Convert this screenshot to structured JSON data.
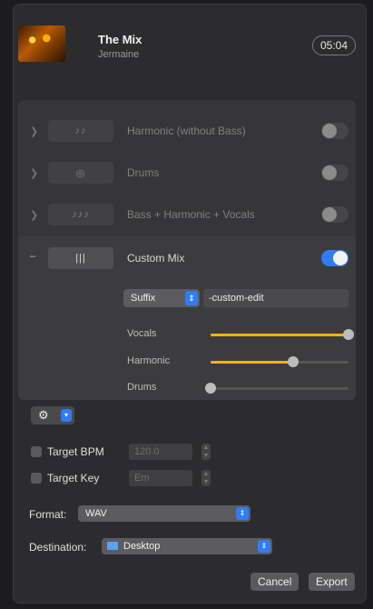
{
  "header": {
    "title": "The Mix",
    "artist": "Jermaine",
    "duration": "05:04"
  },
  "stems": [
    {
      "label": "Harmonic (without Bass)",
      "thumb": "♪♪",
      "enabled": false,
      "dimmed": true
    },
    {
      "label": "Drums",
      "thumb": "◎",
      "enabled": false,
      "dimmed": true
    },
    {
      "label": "Bass + Harmonic + Vocals",
      "thumb": "♪♪♪",
      "enabled": false,
      "dimmed": true
    },
    {
      "label": "Custom Mix",
      "thumb": "|||",
      "enabled": true,
      "dimmed": false
    }
  ],
  "custom": {
    "suffix_select": "Suffix",
    "suffix_value": "-custom-edit",
    "sliders": [
      {
        "label": "Vocals",
        "value": 1.0
      },
      {
        "label": "Harmonic",
        "value": 0.6
      },
      {
        "label": "Drums",
        "value": 0.0
      }
    ]
  },
  "options": {
    "target_bpm_label": "Target BPM",
    "target_bpm_value": "120.0",
    "target_key_label": "Target Key",
    "target_key_value": "Em"
  },
  "export": {
    "format_label": "Format:",
    "format_value": "WAV",
    "destination_label": "Destination:",
    "destination_value": "Desktop",
    "cancel_label": "Cancel",
    "export_label": "Export"
  },
  "colors": {
    "accent": "#2f7cf6",
    "slider_fill": "#f5b400"
  }
}
